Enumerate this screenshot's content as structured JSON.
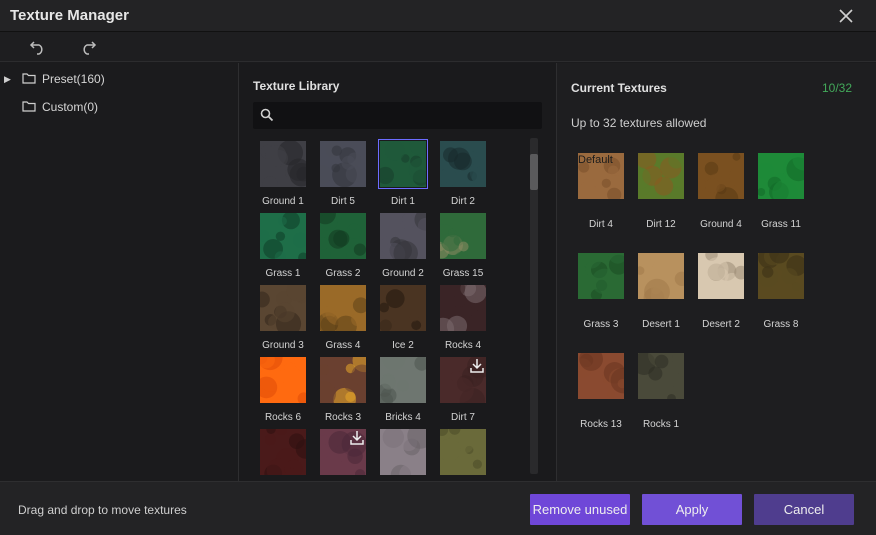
{
  "window": {
    "title": "Texture Manager"
  },
  "toolbar": {
    "undo_icon": "undo-icon",
    "redo_icon": "redo-icon"
  },
  "tree": [
    {
      "label": "Preset(160)",
      "expandable": true
    },
    {
      "label": "Custom(0)",
      "expandable": false
    }
  ],
  "library": {
    "title": "Texture Library",
    "search_placeholder": "",
    "search_value": "",
    "items": [
      {
        "label": "Ground 1",
        "a": "#3f3f45",
        "b": "#26262a",
        "selected": false,
        "download": false
      },
      {
        "label": "Dirt 5",
        "a": "#4a4c58",
        "b": "#33343c",
        "selected": false,
        "download": false
      },
      {
        "label": "Dirt 1",
        "a": "#1f5a3a",
        "b": "#173e2b",
        "selected": true,
        "download": false
      },
      {
        "label": "Dirt 2",
        "a": "#2a4c4e",
        "b": "#182a2c",
        "selected": false,
        "download": false
      },
      {
        "label": "Grass 1",
        "a": "#1e6e48",
        "b": "#0f3e28",
        "selected": false,
        "download": false
      },
      {
        "label": "Grass 2",
        "a": "#1f6238",
        "b": "#123a20",
        "selected": false,
        "download": false
      },
      {
        "label": "Ground 2",
        "a": "#54525e",
        "b": "#35343b",
        "selected": false,
        "download": false
      },
      {
        "label": "Grass 15",
        "a": "#2f6a3a",
        "b": "#8e8a62",
        "selected": false,
        "download": false
      },
      {
        "label": "Ground 3",
        "a": "#5a4632",
        "b": "#33271b",
        "selected": false,
        "download": false
      },
      {
        "label": "Grass 4",
        "a": "#9a6a28",
        "b": "#5e4218",
        "selected": false,
        "download": false
      },
      {
        "label": "Ice 2",
        "a": "#4a3422",
        "b": "#22170f",
        "selected": false,
        "download": false
      },
      {
        "label": "Rocks 4",
        "a": "#3a2426",
        "b": "#7a6a6e",
        "selected": false,
        "download": false
      },
      {
        "label": "Rocks 6",
        "a": "#ff6a10",
        "b": "#e04a08",
        "selected": false,
        "download": false
      },
      {
        "label": "Rocks 3",
        "a": "#6a4030",
        "b": "#e8a82a",
        "selected": false,
        "download": false
      },
      {
        "label": "Bricks 4",
        "a": "#6e7670",
        "b": "#4e5650",
        "selected": false,
        "download": false
      },
      {
        "label": "Dirt 7",
        "a": "#4a2a2a",
        "b": "#3a2020",
        "selected": false,
        "download": true
      },
      {
        "label": "",
        "a": "#4a1a1a",
        "b": "#2e1010",
        "selected": false,
        "download": false
      },
      {
        "label": "",
        "a": "#6a3a4a",
        "b": "#4a2838",
        "selected": false,
        "download": true
      },
      {
        "label": "",
        "a": "#8a8088",
        "b": "#6a6268",
        "selected": false,
        "download": false
      },
      {
        "label": "",
        "a": "#6a6a3a",
        "b": "#4a4a28",
        "selected": false,
        "download": false
      }
    ]
  },
  "current": {
    "title": "Current Textures",
    "count": "10/32",
    "count_color": "#43a95a",
    "note": "Up to 32 textures allowed",
    "default_label": "Default",
    "items": [
      {
        "label": "Dirt 4",
        "a": "#9a6a3e",
        "b": "#7a4e2a",
        "is_default": true
      },
      {
        "label": "Dirt 12",
        "a": "#5a7a2a",
        "b": "#8a5a20"
      },
      {
        "label": "Ground 4",
        "a": "#7a5020",
        "b": "#5a3a14"
      },
      {
        "label": "Grass 11",
        "a": "#1e8a38",
        "b": "#126a28"
      },
      {
        "label": "Grass 3",
        "a": "#2a6a34",
        "b": "#1a4a22"
      },
      {
        "label": "Desert 1",
        "a": "#b8915e",
        "b": "#a07a4a"
      },
      {
        "label": "Desert 2",
        "a": "#d8c8b0",
        "b": "#9a8a74"
      },
      {
        "label": "Grass 8",
        "a": "#5a4a20",
        "b": "#3a3016"
      },
      {
        "label": "Rocks 13",
        "a": "#8a4a30",
        "b": "#6a3420"
      },
      {
        "label": "Rocks 1",
        "a": "#4a4a3a",
        "b": "#2e2e24"
      }
    ]
  },
  "footer": {
    "hint": "Drag and drop to move textures",
    "remove_label": "Remove unused",
    "apply_label": "Apply",
    "cancel_label": "Cancel"
  }
}
